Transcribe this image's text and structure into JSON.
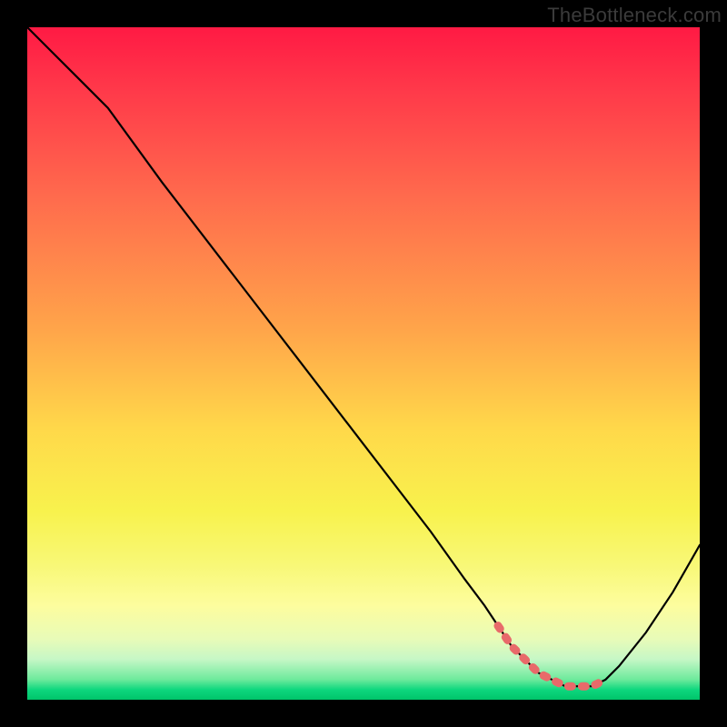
{
  "watermark": "TheBottleneck.com",
  "chart_data": {
    "type": "line",
    "title": "",
    "xlabel": "",
    "ylabel": "",
    "xlim": [
      0,
      100
    ],
    "ylim": [
      0,
      100
    ],
    "x": [
      0,
      4,
      8,
      12,
      20,
      30,
      40,
      50,
      60,
      65,
      68,
      70,
      72,
      74,
      76,
      78,
      80,
      82,
      84,
      86,
      88,
      92,
      96,
      100
    ],
    "values": [
      100,
      96,
      92,
      88,
      77,
      64,
      51,
      38,
      25,
      18,
      14,
      11,
      8,
      6,
      4,
      3,
      2,
      2,
      2,
      3,
      5,
      10,
      16,
      23
    ],
    "highlight_range_x": [
      69,
      87
    ],
    "gradient_stops": [
      {
        "pos": 0,
        "color": "#ff1a44"
      },
      {
        "pos": 45,
        "color": "#ffa54a"
      },
      {
        "pos": 72,
        "color": "#f8f24d"
      },
      {
        "pos": 97,
        "color": "#6dea9c"
      },
      {
        "pos": 100,
        "color": "#00c46a"
      }
    ]
  }
}
